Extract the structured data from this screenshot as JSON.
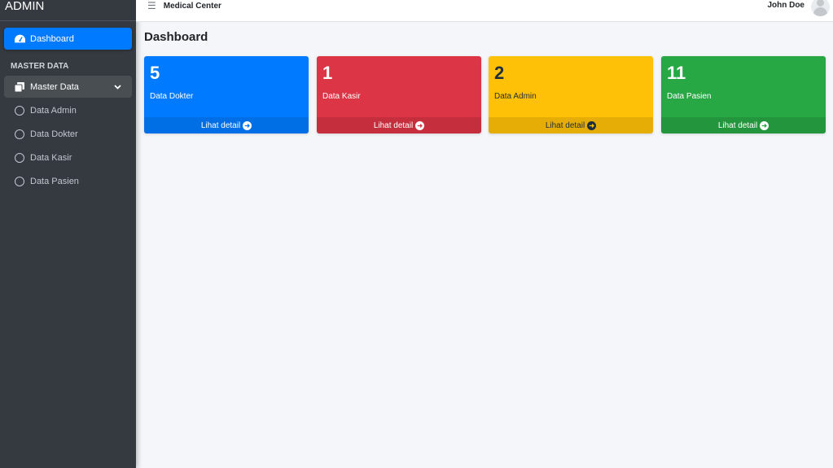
{
  "brand": {
    "title": "ADMIN"
  },
  "sidebar": {
    "dashboard_label": "Dashboard",
    "section_header": "MASTER DATA",
    "master_label": "Master Data",
    "items": [
      {
        "label": "Data Admin"
      },
      {
        "label": "Data Dokter"
      },
      {
        "label": "Data Kasir"
      },
      {
        "label": "Data Pasien"
      }
    ]
  },
  "topbar": {
    "menu_icon": "hamburger-icon",
    "title": "Medical Center",
    "user": "John Doe"
  },
  "main": {
    "page_title": "Dashboard",
    "cards": [
      {
        "count": "5",
        "label": "Data Dokter",
        "link": "Lihat detail",
        "color": "#007bff"
      },
      {
        "count": "1",
        "label": "Data Kasir",
        "link": "Lihat detail",
        "color": "#dc3545"
      },
      {
        "count": "2",
        "label": "Data Admin",
        "link": "Lihat detail",
        "color": "#ffc107"
      },
      {
        "count": "11",
        "label": "Data Pasien",
        "link": "Lihat detail",
        "color": "#28a745"
      }
    ]
  }
}
